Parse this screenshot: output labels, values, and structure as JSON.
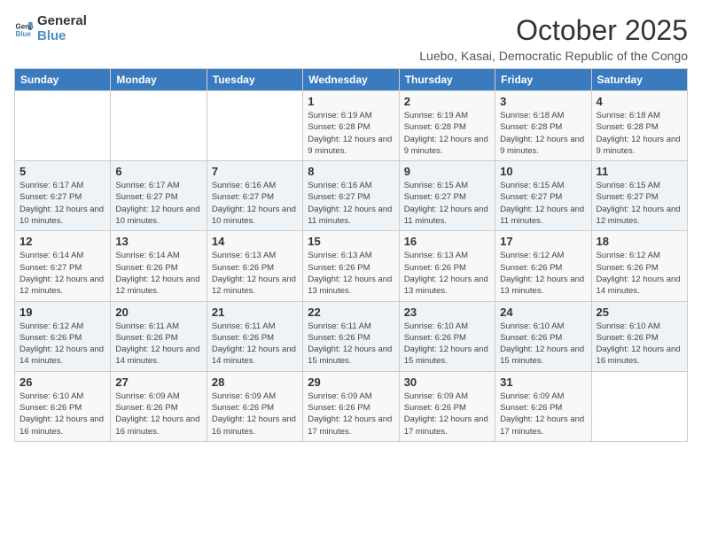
{
  "logo": {
    "text_general": "General",
    "text_blue": "Blue"
  },
  "title": "October 2025",
  "subtitle": "Luebo, Kasai, Democratic Republic of the Congo",
  "days_of_week": [
    "Sunday",
    "Monday",
    "Tuesday",
    "Wednesday",
    "Thursday",
    "Friday",
    "Saturday"
  ],
  "weeks": [
    [
      {
        "day": "",
        "info": ""
      },
      {
        "day": "",
        "info": ""
      },
      {
        "day": "",
        "info": ""
      },
      {
        "day": "1",
        "info": "Sunrise: 6:19 AM\nSunset: 6:28 PM\nDaylight: 12 hours and 9 minutes."
      },
      {
        "day": "2",
        "info": "Sunrise: 6:19 AM\nSunset: 6:28 PM\nDaylight: 12 hours and 9 minutes."
      },
      {
        "day": "3",
        "info": "Sunrise: 6:18 AM\nSunset: 6:28 PM\nDaylight: 12 hours and 9 minutes."
      },
      {
        "day": "4",
        "info": "Sunrise: 6:18 AM\nSunset: 6:28 PM\nDaylight: 12 hours and 9 minutes."
      }
    ],
    [
      {
        "day": "5",
        "info": "Sunrise: 6:17 AM\nSunset: 6:27 PM\nDaylight: 12 hours and 10 minutes."
      },
      {
        "day": "6",
        "info": "Sunrise: 6:17 AM\nSunset: 6:27 PM\nDaylight: 12 hours and 10 minutes."
      },
      {
        "day": "7",
        "info": "Sunrise: 6:16 AM\nSunset: 6:27 PM\nDaylight: 12 hours and 10 minutes."
      },
      {
        "day": "8",
        "info": "Sunrise: 6:16 AM\nSunset: 6:27 PM\nDaylight: 12 hours and 11 minutes."
      },
      {
        "day": "9",
        "info": "Sunrise: 6:15 AM\nSunset: 6:27 PM\nDaylight: 12 hours and 11 minutes."
      },
      {
        "day": "10",
        "info": "Sunrise: 6:15 AM\nSunset: 6:27 PM\nDaylight: 12 hours and 11 minutes."
      },
      {
        "day": "11",
        "info": "Sunrise: 6:15 AM\nSunset: 6:27 PM\nDaylight: 12 hours and 12 minutes."
      }
    ],
    [
      {
        "day": "12",
        "info": "Sunrise: 6:14 AM\nSunset: 6:27 PM\nDaylight: 12 hours and 12 minutes."
      },
      {
        "day": "13",
        "info": "Sunrise: 6:14 AM\nSunset: 6:26 PM\nDaylight: 12 hours and 12 minutes."
      },
      {
        "day": "14",
        "info": "Sunrise: 6:13 AM\nSunset: 6:26 PM\nDaylight: 12 hours and 12 minutes."
      },
      {
        "day": "15",
        "info": "Sunrise: 6:13 AM\nSunset: 6:26 PM\nDaylight: 12 hours and 13 minutes."
      },
      {
        "day": "16",
        "info": "Sunrise: 6:13 AM\nSunset: 6:26 PM\nDaylight: 12 hours and 13 minutes."
      },
      {
        "day": "17",
        "info": "Sunrise: 6:12 AM\nSunset: 6:26 PM\nDaylight: 12 hours and 13 minutes."
      },
      {
        "day": "18",
        "info": "Sunrise: 6:12 AM\nSunset: 6:26 PM\nDaylight: 12 hours and 14 minutes."
      }
    ],
    [
      {
        "day": "19",
        "info": "Sunrise: 6:12 AM\nSunset: 6:26 PM\nDaylight: 12 hours and 14 minutes."
      },
      {
        "day": "20",
        "info": "Sunrise: 6:11 AM\nSunset: 6:26 PM\nDaylight: 12 hours and 14 minutes."
      },
      {
        "day": "21",
        "info": "Sunrise: 6:11 AM\nSunset: 6:26 PM\nDaylight: 12 hours and 14 minutes."
      },
      {
        "day": "22",
        "info": "Sunrise: 6:11 AM\nSunset: 6:26 PM\nDaylight: 12 hours and 15 minutes."
      },
      {
        "day": "23",
        "info": "Sunrise: 6:10 AM\nSunset: 6:26 PM\nDaylight: 12 hours and 15 minutes."
      },
      {
        "day": "24",
        "info": "Sunrise: 6:10 AM\nSunset: 6:26 PM\nDaylight: 12 hours and 15 minutes."
      },
      {
        "day": "25",
        "info": "Sunrise: 6:10 AM\nSunset: 6:26 PM\nDaylight: 12 hours and 16 minutes."
      }
    ],
    [
      {
        "day": "26",
        "info": "Sunrise: 6:10 AM\nSunset: 6:26 PM\nDaylight: 12 hours and 16 minutes."
      },
      {
        "day": "27",
        "info": "Sunrise: 6:09 AM\nSunset: 6:26 PM\nDaylight: 12 hours and 16 minutes."
      },
      {
        "day": "28",
        "info": "Sunrise: 6:09 AM\nSunset: 6:26 PM\nDaylight: 12 hours and 16 minutes."
      },
      {
        "day": "29",
        "info": "Sunrise: 6:09 AM\nSunset: 6:26 PM\nDaylight: 12 hours and 17 minutes."
      },
      {
        "day": "30",
        "info": "Sunrise: 6:09 AM\nSunset: 6:26 PM\nDaylight: 12 hours and 17 minutes."
      },
      {
        "day": "31",
        "info": "Sunrise: 6:09 AM\nSunset: 6:26 PM\nDaylight: 12 hours and 17 minutes."
      },
      {
        "day": "",
        "info": ""
      }
    ]
  ]
}
